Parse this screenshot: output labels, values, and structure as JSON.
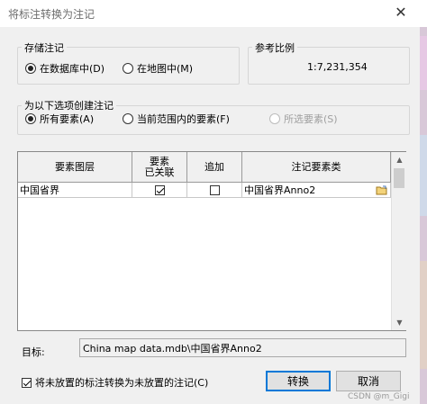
{
  "window": {
    "title": "将标注转换为注记",
    "close_glyph": "✕"
  },
  "storage": {
    "legend": "存储注记",
    "options": [
      {
        "label": "在数据库中(D)",
        "checked": true
      },
      {
        "label": "在地图中(M)",
        "checked": false
      }
    ]
  },
  "reference_scale": {
    "legend": "参考比例",
    "value": "1:7,231,354"
  },
  "create_for": {
    "legend": "为以下选项创建注记",
    "options": [
      {
        "label": "所有要素(A)",
        "checked": true,
        "enabled": true
      },
      {
        "label": "当前范围内的要素(F)",
        "checked": false,
        "enabled": true
      },
      {
        "label": "所选要素(S)",
        "checked": false,
        "enabled": false
      }
    ]
  },
  "table": {
    "columns": [
      "要素图层",
      "要素\n已关联",
      "追加",
      "注记要素类"
    ],
    "rows": [
      {
        "layer": "中国省界",
        "linked": true,
        "append": false,
        "anno_class": "中国省界Anno2"
      }
    ]
  },
  "target": {
    "label": "目标:",
    "value": "China map data.mdb\\中国省界Anno2"
  },
  "convert_unplaced": {
    "label": "将未放置的标注转换为未放置的注记(C)",
    "checked": true
  },
  "buttons": {
    "convert": "转换",
    "cancel": "取消"
  },
  "watermark": "CSDN @m_Gigi"
}
